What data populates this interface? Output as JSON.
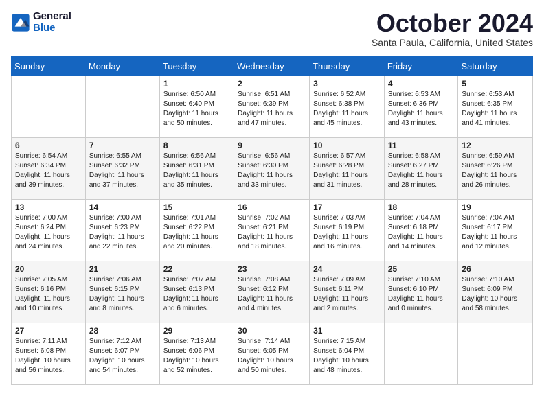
{
  "logo": {
    "line1": "General",
    "line2": "Blue"
  },
  "title": "October 2024",
  "location": "Santa Paula, California, United States",
  "weekdays": [
    "Sunday",
    "Monday",
    "Tuesday",
    "Wednesday",
    "Thursday",
    "Friday",
    "Saturday"
  ],
  "weeks": [
    [
      {
        "day": "",
        "content": ""
      },
      {
        "day": "",
        "content": ""
      },
      {
        "day": "1",
        "content": "Sunrise: 6:50 AM\nSunset: 6:40 PM\nDaylight: 11 hours and 50 minutes."
      },
      {
        "day": "2",
        "content": "Sunrise: 6:51 AM\nSunset: 6:39 PM\nDaylight: 11 hours and 47 minutes."
      },
      {
        "day": "3",
        "content": "Sunrise: 6:52 AM\nSunset: 6:38 PM\nDaylight: 11 hours and 45 minutes."
      },
      {
        "day": "4",
        "content": "Sunrise: 6:53 AM\nSunset: 6:36 PM\nDaylight: 11 hours and 43 minutes."
      },
      {
        "day": "5",
        "content": "Sunrise: 6:53 AM\nSunset: 6:35 PM\nDaylight: 11 hours and 41 minutes."
      }
    ],
    [
      {
        "day": "6",
        "content": "Sunrise: 6:54 AM\nSunset: 6:34 PM\nDaylight: 11 hours and 39 minutes."
      },
      {
        "day": "7",
        "content": "Sunrise: 6:55 AM\nSunset: 6:32 PM\nDaylight: 11 hours and 37 minutes."
      },
      {
        "day": "8",
        "content": "Sunrise: 6:56 AM\nSunset: 6:31 PM\nDaylight: 11 hours and 35 minutes."
      },
      {
        "day": "9",
        "content": "Sunrise: 6:56 AM\nSunset: 6:30 PM\nDaylight: 11 hours and 33 minutes."
      },
      {
        "day": "10",
        "content": "Sunrise: 6:57 AM\nSunset: 6:28 PM\nDaylight: 11 hours and 31 minutes."
      },
      {
        "day": "11",
        "content": "Sunrise: 6:58 AM\nSunset: 6:27 PM\nDaylight: 11 hours and 28 minutes."
      },
      {
        "day": "12",
        "content": "Sunrise: 6:59 AM\nSunset: 6:26 PM\nDaylight: 11 hours and 26 minutes."
      }
    ],
    [
      {
        "day": "13",
        "content": "Sunrise: 7:00 AM\nSunset: 6:24 PM\nDaylight: 11 hours and 24 minutes."
      },
      {
        "day": "14",
        "content": "Sunrise: 7:00 AM\nSunset: 6:23 PM\nDaylight: 11 hours and 22 minutes."
      },
      {
        "day": "15",
        "content": "Sunrise: 7:01 AM\nSunset: 6:22 PM\nDaylight: 11 hours and 20 minutes."
      },
      {
        "day": "16",
        "content": "Sunrise: 7:02 AM\nSunset: 6:21 PM\nDaylight: 11 hours and 18 minutes."
      },
      {
        "day": "17",
        "content": "Sunrise: 7:03 AM\nSunset: 6:19 PM\nDaylight: 11 hours and 16 minutes."
      },
      {
        "day": "18",
        "content": "Sunrise: 7:04 AM\nSunset: 6:18 PM\nDaylight: 11 hours and 14 minutes."
      },
      {
        "day": "19",
        "content": "Sunrise: 7:04 AM\nSunset: 6:17 PM\nDaylight: 11 hours and 12 minutes."
      }
    ],
    [
      {
        "day": "20",
        "content": "Sunrise: 7:05 AM\nSunset: 6:16 PM\nDaylight: 11 hours and 10 minutes."
      },
      {
        "day": "21",
        "content": "Sunrise: 7:06 AM\nSunset: 6:15 PM\nDaylight: 11 hours and 8 minutes."
      },
      {
        "day": "22",
        "content": "Sunrise: 7:07 AM\nSunset: 6:13 PM\nDaylight: 11 hours and 6 minutes."
      },
      {
        "day": "23",
        "content": "Sunrise: 7:08 AM\nSunset: 6:12 PM\nDaylight: 11 hours and 4 minutes."
      },
      {
        "day": "24",
        "content": "Sunrise: 7:09 AM\nSunset: 6:11 PM\nDaylight: 11 hours and 2 minutes."
      },
      {
        "day": "25",
        "content": "Sunrise: 7:10 AM\nSunset: 6:10 PM\nDaylight: 11 hours and 0 minutes."
      },
      {
        "day": "26",
        "content": "Sunrise: 7:10 AM\nSunset: 6:09 PM\nDaylight: 10 hours and 58 minutes."
      }
    ],
    [
      {
        "day": "27",
        "content": "Sunrise: 7:11 AM\nSunset: 6:08 PM\nDaylight: 10 hours and 56 minutes."
      },
      {
        "day": "28",
        "content": "Sunrise: 7:12 AM\nSunset: 6:07 PM\nDaylight: 10 hours and 54 minutes."
      },
      {
        "day": "29",
        "content": "Sunrise: 7:13 AM\nSunset: 6:06 PM\nDaylight: 10 hours and 52 minutes."
      },
      {
        "day": "30",
        "content": "Sunrise: 7:14 AM\nSunset: 6:05 PM\nDaylight: 10 hours and 50 minutes."
      },
      {
        "day": "31",
        "content": "Sunrise: 7:15 AM\nSunset: 6:04 PM\nDaylight: 10 hours and 48 minutes."
      },
      {
        "day": "",
        "content": ""
      },
      {
        "day": "",
        "content": ""
      }
    ]
  ]
}
